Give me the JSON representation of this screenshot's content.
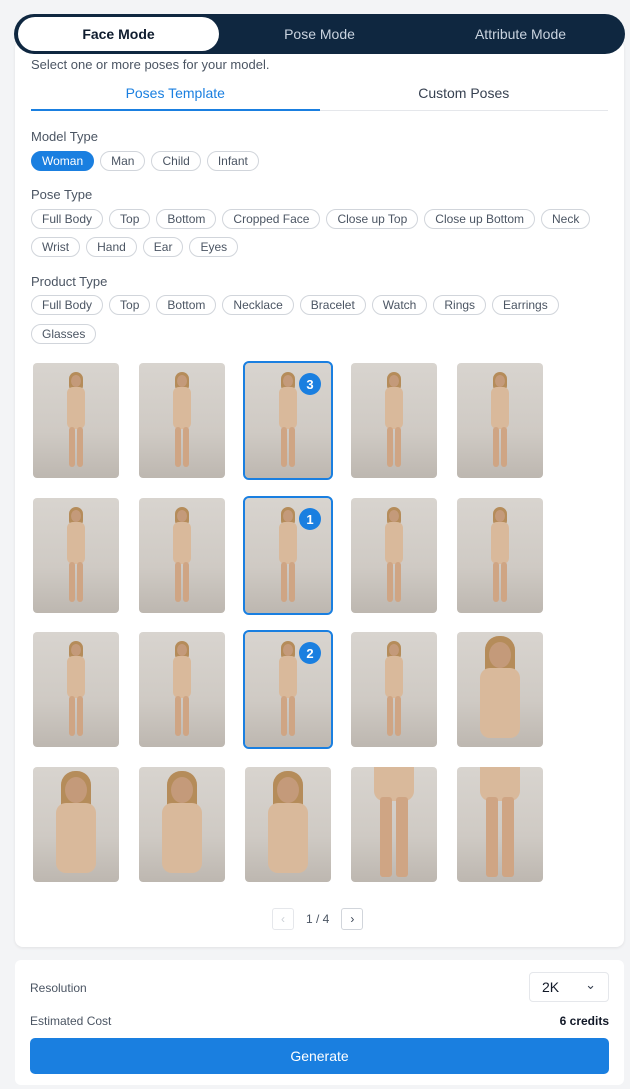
{
  "modes": {
    "face": "Face Mode",
    "pose": "Pose Mode",
    "attribute": "Attribute Mode"
  },
  "subtitle": "Select one or more poses for your model.",
  "pose_tabs": {
    "template": "Poses Template",
    "custom": "Custom Poses"
  },
  "model_type": {
    "label": "Model Type",
    "options": [
      "Woman",
      "Man",
      "Child",
      "Infant"
    ],
    "selected": "Woman"
  },
  "pose_type": {
    "label": "Pose Type",
    "options": [
      "Full Body",
      "Top",
      "Bottom",
      "Cropped Face",
      "Close up Top",
      "Close up Bottom",
      "Neck",
      "Wrist",
      "Hand",
      "Ear",
      "Eyes"
    ]
  },
  "product_type": {
    "label": "Product Type",
    "options": [
      "Full Body",
      "Top",
      "Bottom",
      "Necklace",
      "Bracelet",
      "Watch",
      "Rings",
      "Earrings",
      "Glasses"
    ]
  },
  "selection_badges": {
    "r0c2": "3",
    "r1c2": "1",
    "r2c2": "2"
  },
  "pagination": {
    "prev": "‹",
    "text": "1 / 4",
    "next": "›"
  },
  "resolution": {
    "label": "Resolution",
    "value": "2K",
    "chevron": "⌄"
  },
  "cost": {
    "label": "Estimated Cost",
    "value": "6 credits"
  },
  "generate_label": "Generate",
  "colors": {
    "accent": "#1a7fe0",
    "mode_bar": "#0f2740"
  }
}
